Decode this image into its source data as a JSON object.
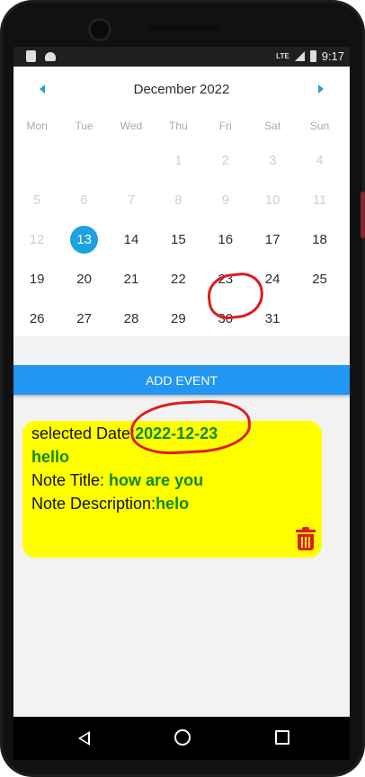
{
  "statusbar": {
    "time": "9:17",
    "network": "LTE"
  },
  "calendar": {
    "month_title": "December 2022",
    "weekdays": [
      "Mon",
      "Tue",
      "Wed",
      "Thu",
      "Fri",
      "Sat",
      "Sun"
    ],
    "rows": [
      [
        "",
        "",
        "",
        "1",
        "2",
        "3",
        "4"
      ],
      [
        "5",
        "6",
        "7",
        "8",
        "9",
        "10",
        "11"
      ],
      [
        "12",
        "13",
        "14",
        "15",
        "16",
        "17",
        "18"
      ],
      [
        "19",
        "20",
        "21",
        "22",
        "23",
        "24",
        "25"
      ],
      [
        "26",
        "27",
        "28",
        "29",
        "30",
        "31",
        ""
      ]
    ],
    "today": "13",
    "marked": "23"
  },
  "add_event": {
    "label": "ADD EVENT"
  },
  "note": {
    "selected_label": "selected Date:",
    "selected_value": "2022-12-23",
    "event_name": "hello",
    "title_label": "Note Title: ",
    "title_value": "how are you",
    "desc_label": "Note Description:",
    "desc_value": "helo"
  },
  "colors": {
    "accent": "#2196f3",
    "today": "#1da1e0",
    "card": "#ffff00",
    "green_text": "#118811",
    "annotation_red": "#e01a1a"
  }
}
